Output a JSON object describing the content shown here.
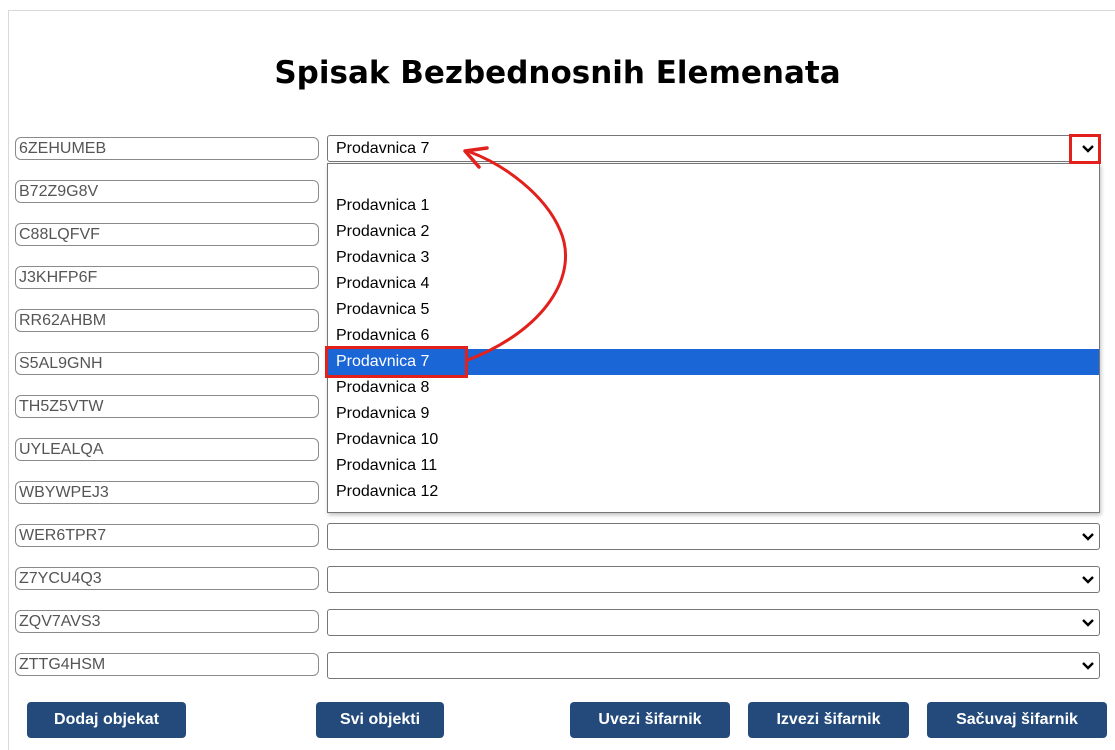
{
  "page": {
    "title": "Spisak Bezbednosnih Elemenata"
  },
  "rows": [
    {
      "code": "6ZEHUMEB",
      "selected": "Prodavnica 7"
    },
    {
      "code": "B72Z9G8V",
      "selected": ""
    },
    {
      "code": "C88LQFVF",
      "selected": ""
    },
    {
      "code": "J3KHFP6F",
      "selected": ""
    },
    {
      "code": "RR62AHBM",
      "selected": ""
    },
    {
      "code": "S5AL9GNH",
      "selected": ""
    },
    {
      "code": "TH5Z5VTW",
      "selected": ""
    },
    {
      "code": "UYLEALQA",
      "selected": ""
    },
    {
      "code": "WBYWPEJ3",
      "selected": ""
    },
    {
      "code": "WER6TPR7",
      "selected": ""
    },
    {
      "code": "Z7YCU4Q3",
      "selected": ""
    },
    {
      "code": "ZQV7AVS3",
      "selected": ""
    },
    {
      "code": "ZTTG4HSM",
      "selected": ""
    }
  ],
  "dropdown": {
    "options": [
      "",
      "Prodavnica 1",
      "Prodavnica 2",
      "Prodavnica 3",
      "Prodavnica 4",
      "Prodavnica 5",
      "Prodavnica 6",
      "Prodavnica 7",
      "Prodavnica 8",
      "Prodavnica 9",
      "Prodavnica 10",
      "Prodavnica 11",
      "Prodavnica 12"
    ],
    "highlighted": "Prodavnica 7"
  },
  "buttons": {
    "add_object": "Dodaj objekat",
    "all_objects": "Svi objekti",
    "import_codebook": "Uvezi šifarnik",
    "export_codebook": "Izvezi šifarnik",
    "save_codebook": "Sačuvaj šifarnik"
  },
  "colors": {
    "button_bg": "#234a7a",
    "highlight_option": "#1a66d6",
    "annotation": "#e2201c"
  },
  "icons": {
    "select_caret": "chevron-down-icon",
    "annotation_arrow": "curved-arrow-icon"
  }
}
